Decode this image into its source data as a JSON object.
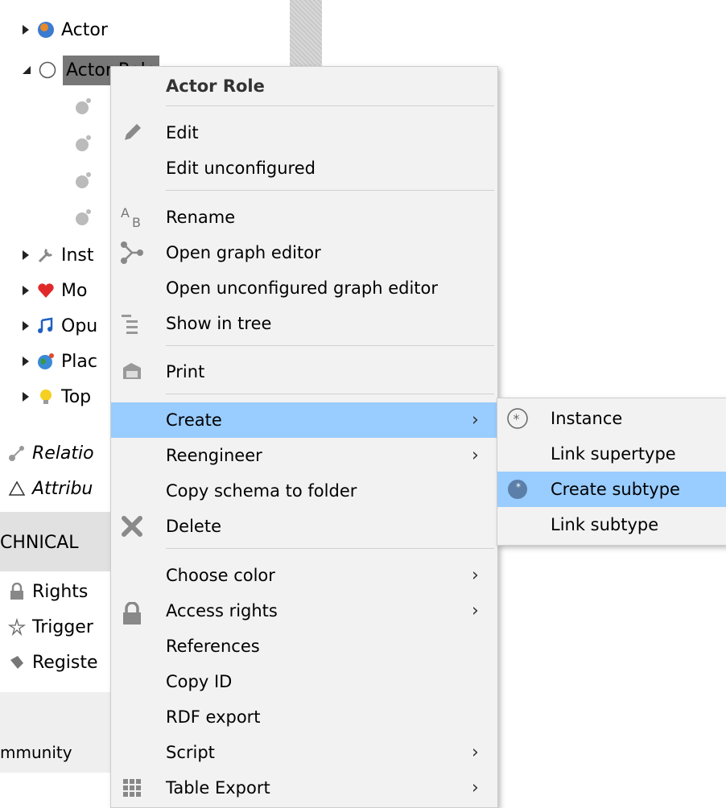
{
  "tree": {
    "items": [
      {
        "label": "Actor"
      },
      {
        "label": "Actor Role"
      },
      {
        "label": "Inst"
      },
      {
        "label": "Mo"
      },
      {
        "label": "Opu"
      },
      {
        "label": "Plac"
      },
      {
        "label": "Top"
      },
      {
        "label": "Relatio"
      },
      {
        "label": "Attribu"
      }
    ],
    "section_label": "CHNICAL",
    "tech_items": [
      {
        "label": "Rights"
      },
      {
        "label": "Trigger"
      },
      {
        "label": "Registe"
      }
    ],
    "footer_label": "mmunity"
  },
  "menu": {
    "header": "Actor Role",
    "items": [
      {
        "label": "Edit",
        "icon": "pencil-icon"
      },
      {
        "label": "Edit unconfigured"
      },
      {
        "label": "Rename",
        "icon": "rename-icon"
      },
      {
        "label": "Open graph editor",
        "icon": "graph-icon"
      },
      {
        "label": "Open unconfigured graph editor"
      },
      {
        "label": "Show in tree",
        "icon": "tree-icon"
      },
      {
        "label": "Print",
        "icon": "printer-icon"
      },
      {
        "label": "Create",
        "has_submenu": true,
        "highlighted": true
      },
      {
        "label": "Reengineer",
        "has_submenu": true
      },
      {
        "label": "Copy schema to folder"
      },
      {
        "label": "Delete",
        "icon": "delete-icon"
      },
      {
        "label": "Choose color",
        "has_submenu": true
      },
      {
        "label": "Access rights",
        "has_submenu": true,
        "icon": "lock-icon"
      },
      {
        "label": "References"
      },
      {
        "label": "Copy ID"
      },
      {
        "label": "RDF export"
      },
      {
        "label": "Script",
        "has_submenu": true
      },
      {
        "label": "Table Export",
        "has_submenu": true,
        "icon": "grid-icon"
      }
    ],
    "arrow": "›"
  },
  "submenu": {
    "items": [
      {
        "label": "Instance",
        "icon": "instance-icon"
      },
      {
        "label": "Link supertype"
      },
      {
        "label": "Create subtype",
        "icon": "subtype-icon",
        "highlighted": true
      },
      {
        "label": "Link subtype"
      }
    ]
  },
  "colors": {
    "highlight": "#99ccff",
    "menu_bg": "#f2f2f2"
  }
}
